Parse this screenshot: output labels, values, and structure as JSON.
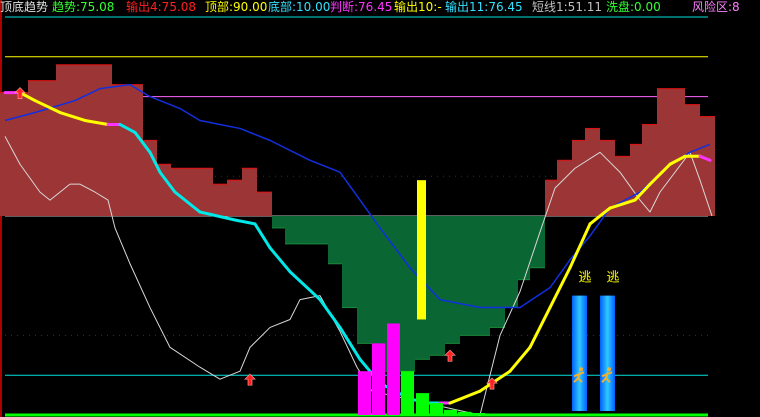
{
  "header": {
    "title": {
      "text": "顶底趋势",
      "color": "#e0e0e0"
    },
    "items": [
      {
        "text": "趋势:75.08",
        "color": "#33ff33"
      },
      {
        "text": "输出4:75.08",
        "color": "#ff2020"
      },
      {
        "text": "顶部:90.00",
        "color": "#ffff00"
      },
      {
        "text": "底部:10.00",
        "color": "#33e0ff"
      },
      {
        "text": "判断:76.45",
        "color": "#ff33ff"
      },
      {
        "text": "输出10:-",
        "color": "#ffff00"
      },
      {
        "text": "输出11:76.45",
        "color": "#33e0ff"
      },
      {
        "text": "短线1:51.11",
        "color": "#c0c0c0"
      },
      {
        "text": "洗盘:0.00",
        "color": "#33ff33"
      },
      {
        "text": "风险区:8",
        "color": "#ff80ff"
      }
    ]
  },
  "signals": {
    "escape_label": "逃"
  },
  "chart_data": {
    "type": "indicator",
    "title": "顶底趋势",
    "ylim": [
      0,
      100
    ],
    "reference_lines": [
      {
        "value": 100,
        "color": "#00e0e0"
      },
      {
        "value": 90,
        "color": "#ffff00"
      },
      {
        "value": 80,
        "color": "#ff66ff"
      },
      {
        "value": 60,
        "color": "#aa0000",
        "style": "dotted"
      },
      {
        "value": 50,
        "color": "#c0c0c0"
      },
      {
        "value": 20,
        "color": "#aa0000",
        "style": "dotted"
      },
      {
        "value": 10,
        "color": "#00e0e0"
      },
      {
        "value": 0,
        "color": "#00ff00"
      }
    ],
    "area_steps": [
      [
        0,
        81
      ],
      [
        28,
        84
      ],
      [
        56,
        88
      ],
      [
        112,
        83
      ],
      [
        143,
        69
      ],
      [
        157,
        63
      ],
      [
        171,
        62
      ],
      [
        213,
        58
      ],
      [
        227,
        59
      ],
      [
        242,
        62
      ],
      [
        257,
        56
      ],
      [
        272,
        47
      ],
      [
        285,
        43
      ],
      [
        300,
        43
      ],
      [
        328,
        38
      ],
      [
        342,
        27
      ],
      [
        357,
        18
      ],
      [
        372,
        11
      ],
      [
        415,
        14
      ],
      [
        430,
        15
      ],
      [
        445,
        18
      ],
      [
        460,
        20
      ],
      [
        490,
        22
      ],
      [
        505,
        27
      ],
      [
        518,
        34
      ],
      [
        530,
        37
      ],
      [
        545,
        59
      ],
      [
        557,
        64
      ],
      [
        572,
        69
      ],
      [
        585,
        72
      ],
      [
        600,
        69
      ],
      [
        615,
        65
      ],
      [
        630,
        68
      ],
      [
        642,
        73
      ],
      [
        657,
        82
      ],
      [
        685,
        78
      ],
      [
        700,
        75
      ],
      [
        715,
        50
      ]
    ],
    "trend_line": [
      [
        5,
        81
      ],
      [
        20,
        81
      ],
      [
        35,
        79
      ],
      [
        60,
        76
      ],
      [
        85,
        74
      ],
      [
        108,
        73
      ],
      [
        120,
        73
      ],
      [
        135,
        71
      ],
      [
        150,
        66
      ],
      [
        160,
        61
      ],
      [
        175,
        56
      ],
      [
        200,
        51
      ],
      [
        235,
        49
      ],
      [
        255,
        48
      ],
      [
        270,
        42
      ],
      [
        290,
        36
      ],
      [
        320,
        29
      ],
      [
        340,
        22
      ],
      [
        360,
        14
      ],
      [
        380,
        8
      ],
      [
        410,
        4
      ],
      [
        430,
        3
      ],
      [
        440,
        3
      ],
      [
        450,
        3
      ],
      [
        480,
        6
      ],
      [
        510,
        11
      ],
      [
        530,
        17
      ],
      [
        550,
        27
      ],
      [
        570,
        37
      ],
      [
        590,
        48
      ],
      [
        610,
        52
      ],
      [
        635,
        54
      ],
      [
        650,
        58
      ],
      [
        670,
        63
      ],
      [
        685,
        65
      ],
      [
        700,
        65
      ],
      [
        710,
        64
      ]
    ],
    "slow_line": [
      [
        5,
        74
      ],
      [
        35,
        76
      ],
      [
        75,
        79
      ],
      [
        100,
        82
      ],
      [
        130,
        83
      ],
      [
        150,
        80
      ],
      [
        180,
        77
      ],
      [
        200,
        74
      ],
      [
        240,
        72
      ],
      [
        270,
        69
      ],
      [
        310,
        64
      ],
      [
        340,
        61
      ],
      [
        360,
        54
      ],
      [
        380,
        47
      ],
      [
        410,
        37
      ],
      [
        440,
        29
      ],
      [
        480,
        27
      ],
      [
        520,
        27
      ],
      [
        550,
        32
      ],
      [
        570,
        39
      ],
      [
        590,
        45
      ],
      [
        610,
        52
      ],
      [
        640,
        56
      ],
      [
        670,
        63
      ],
      [
        690,
        66
      ],
      [
        710,
        68
      ]
    ],
    "short_line": [
      [
        5,
        70
      ],
      [
        20,
        63
      ],
      [
        40,
        56
      ],
      [
        50,
        54
      ],
      [
        70,
        58
      ],
      [
        80,
        58
      ],
      [
        95,
        56
      ],
      [
        108,
        54
      ],
      [
        115,
        47
      ],
      [
        130,
        38
      ],
      [
        150,
        27
      ],
      [
        170,
        17
      ],
      [
        200,
        12
      ],
      [
        220,
        9
      ],
      [
        240,
        11
      ],
      [
        250,
        17
      ],
      [
        270,
        22
      ],
      [
        290,
        24
      ],
      [
        300,
        29
      ],
      [
        320,
        30
      ],
      [
        340,
        21
      ],
      [
        357,
        12
      ],
      [
        372,
        6
      ],
      [
        480,
        0
      ],
      [
        500,
        20
      ],
      [
        520,
        31
      ],
      [
        540,
        46
      ],
      [
        555,
        57
      ],
      [
        575,
        62
      ],
      [
        600,
        66
      ],
      [
        620,
        61
      ],
      [
        640,
        54
      ],
      [
        650,
        51
      ],
      [
        660,
        56
      ],
      [
        690,
        66
      ],
      [
        700,
        59
      ],
      [
        712,
        50
      ]
    ],
    "top_marker_bar": {
      "x": 421,
      "from": 24,
      "to": 59
    },
    "histogram": [
      {
        "x": 364,
        "value": 11,
        "color": "#ff00ff"
      },
      {
        "x": 378,
        "value": 18,
        "color": "#ff00ff"
      },
      {
        "x": 393,
        "value": 23,
        "color": "#ff00ff"
      },
      {
        "x": 407,
        "value": 11,
        "color": "#00ff00"
      },
      {
        "x": 422,
        "value": 5.5,
        "color": "#00ff00"
      },
      {
        "x": 436,
        "value": 3,
        "color": "#00ff00"
      },
      {
        "x": 450,
        "value": 1.3,
        "color": "#00ff00"
      },
      {
        "x": 464,
        "value": 0.8,
        "color": "#00ff00"
      },
      {
        "x": 478,
        "value": 0.5,
        "color": "#00ff00"
      }
    ],
    "escape_bars": [
      {
        "x": 579,
        "from": 1,
        "to": 30
      },
      {
        "x": 607,
        "from": 1,
        "to": 30
      }
    ],
    "buy_arrows": [
      [
        20,
        81
      ],
      [
        250,
        9
      ],
      [
        450,
        15
      ],
      [
        492,
        8
      ]
    ]
  }
}
